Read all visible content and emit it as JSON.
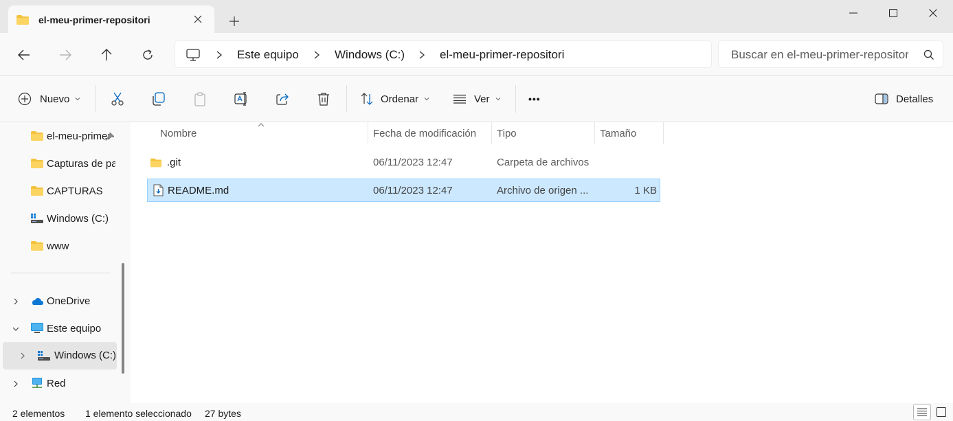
{
  "window": {
    "tab_title": "el-meu-primer-repositori",
    "new_tab_symbol": "+",
    "controls": [
      "minimize-icon",
      "maximize-icon",
      "close-icon"
    ]
  },
  "addressbar": {
    "breadcrumbs": [
      "Este equipo",
      "Windows (C:)",
      "el-meu-primer-repositori"
    ],
    "search_placeholder": "Buscar en el-meu-primer-repositori"
  },
  "toolbar": {
    "new_label": "Nuevo",
    "sort_label": "Ordenar",
    "view_label": "Ver",
    "more_label": "•••",
    "details_label": "Detalles",
    "icons": [
      "cut-icon",
      "copy-icon",
      "paste-icon",
      "rename-icon",
      "share-icon",
      "delete-icon"
    ]
  },
  "sidebar": {
    "items": [
      {
        "label": "el-meu-primer-repositori",
        "icon": "folder-icon",
        "pinned": true
      },
      {
        "label": "Capturas de pantalla",
        "icon": "folder-icon"
      },
      {
        "label": "CAPTURAS",
        "icon": "folder-icon"
      },
      {
        "label": "Windows (C:)",
        "icon": "drive-icon"
      },
      {
        "label": "www",
        "icon": "folder-icon"
      },
      {
        "label": "OneDrive",
        "icon": "cloud-icon"
      },
      {
        "label": "Este equipo",
        "icon": "computer-icon"
      },
      {
        "label": "Windows (C:)",
        "icon": "drive-icon"
      },
      {
        "label": "Red",
        "icon": "network-icon"
      }
    ]
  },
  "files": {
    "columns": [
      "Nombre",
      "Fecha de modificación",
      "Tipo",
      "Tamaño"
    ],
    "rows": [
      {
        "name": ".git",
        "modified": "06/11/2023 12:47",
        "type": "Carpeta de archivos",
        "size": "",
        "icon": "folder-icon"
      },
      {
        "name": "README.md",
        "modified": "06/11/2023 12:47",
        "type": "Archivo de origen ...",
        "size": "1 KB",
        "icon": "markdown-file-icon",
        "selected": true
      }
    ]
  },
  "status": {
    "count": "2 elementos",
    "selection": "1 elemento seleccionado",
    "size": "27 bytes"
  },
  "colors": {
    "selection_bg": "#cce8ff",
    "selection_border": "#99d1ff",
    "folder": "#f3c23f",
    "accent": "#0067c0"
  }
}
